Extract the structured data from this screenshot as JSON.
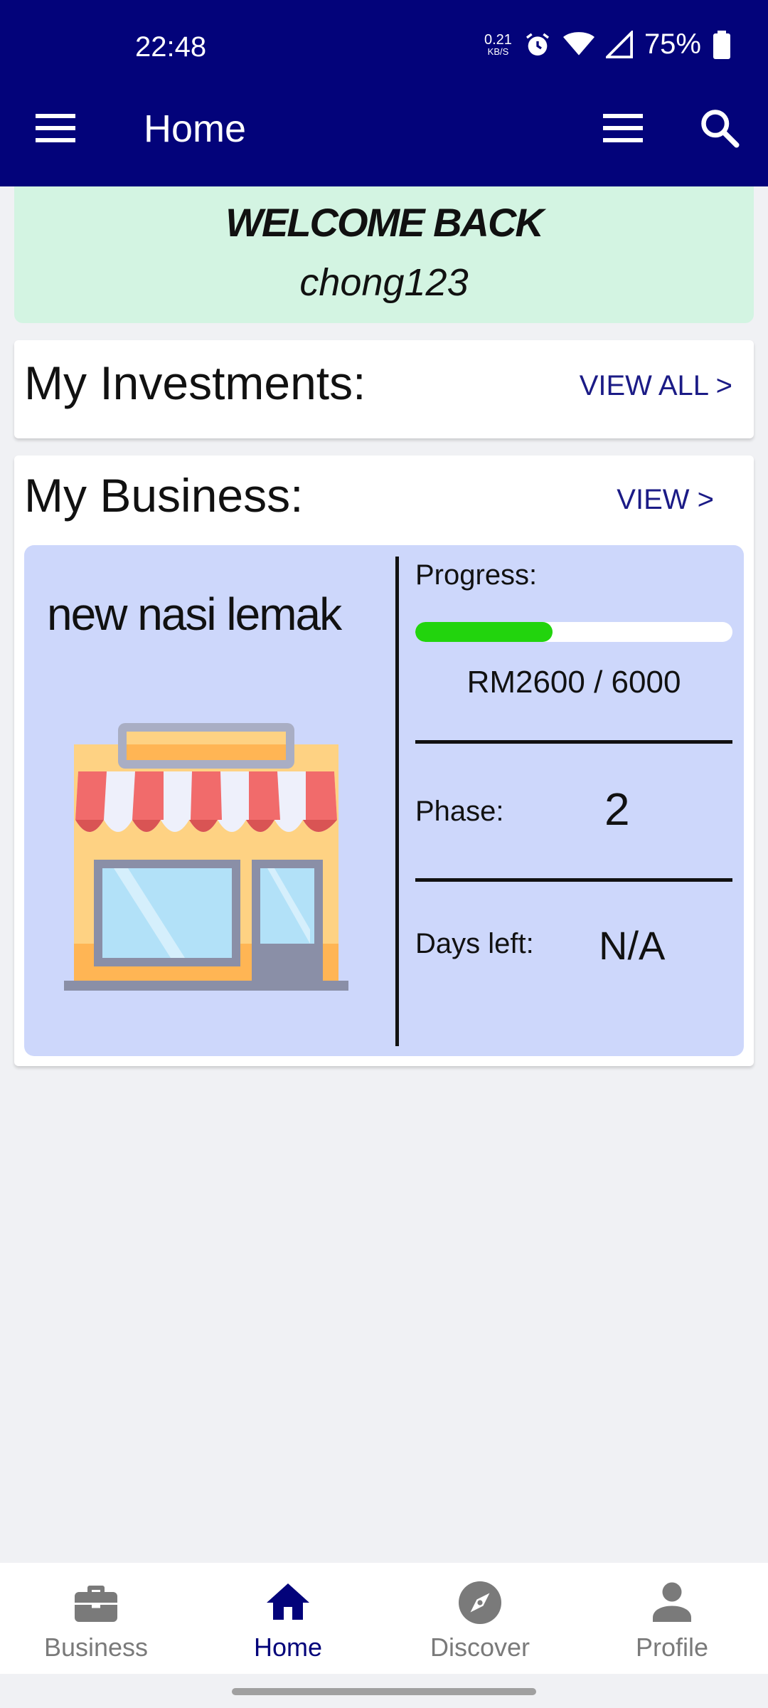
{
  "status_bar": {
    "time": "22:48",
    "net_speed": "0.21",
    "net_unit": "KB/S",
    "battery": "75%"
  },
  "toolbar": {
    "title": "Home",
    "left_icon": "menu-icon",
    "right_icons": [
      "menu-icon",
      "search-icon"
    ]
  },
  "welcome": {
    "title": "WELCOME BACK",
    "username": "chong123"
  },
  "investments": {
    "heading": "My Investments:",
    "link": "VIEW ALL >"
  },
  "business": {
    "heading": "My Business:",
    "link": "VIEW >",
    "item": {
      "name": "new nasi lemak",
      "icon": "shop-icon",
      "progress_label": "Progress:",
      "progress_fraction": 0.4333,
      "progress_amount": "RM2600 / 6000",
      "phase_label": "Phase:",
      "phase_value": "2",
      "days_label": "Days left:",
      "days_value": "N/A"
    }
  },
  "bottom_nav": [
    {
      "label": "Business",
      "icon": "briefcase-icon",
      "active": false
    },
    {
      "label": "Home",
      "icon": "home-icon",
      "active": true
    },
    {
      "label": "Discover",
      "icon": "compass-icon",
      "active": false
    },
    {
      "label": "Profile",
      "icon": "person-icon",
      "active": false
    }
  ],
  "colors": {
    "primary": "#03037a",
    "welcome_bg": "#d3f4e2",
    "panel_bg": "#cdd7fb",
    "progress_fill": "#22d40d"
  }
}
